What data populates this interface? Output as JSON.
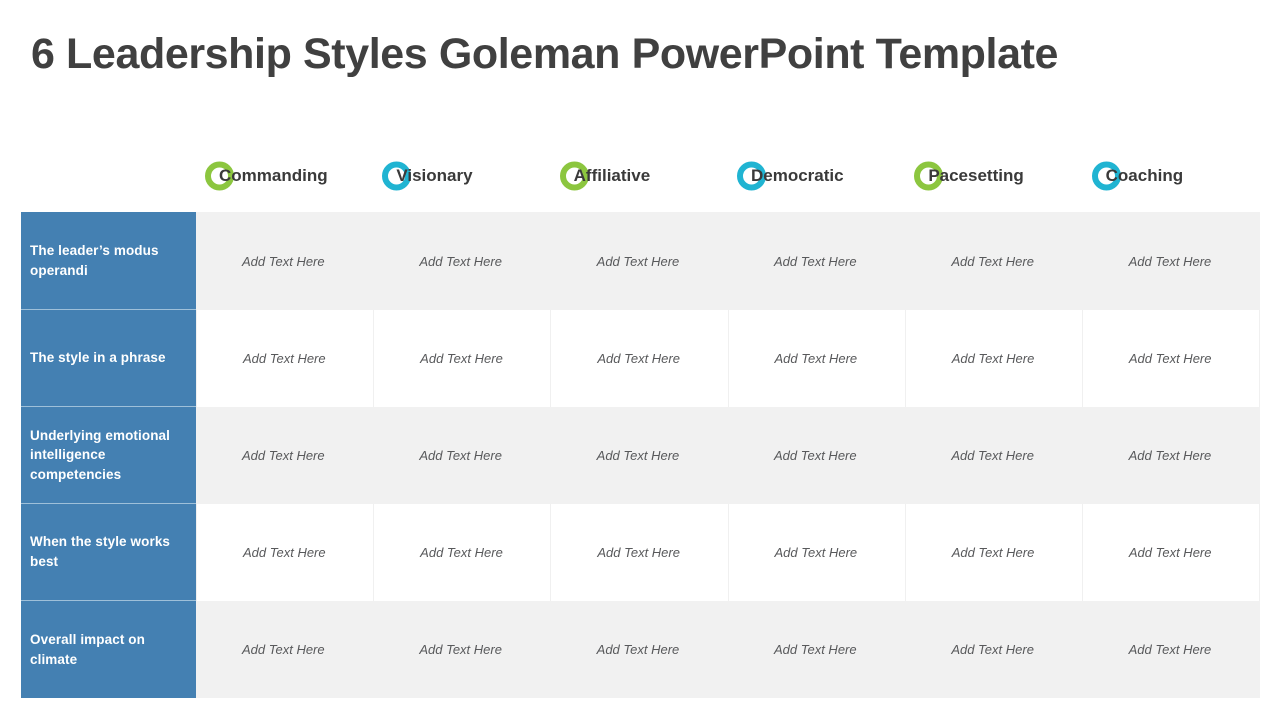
{
  "slide": {
    "title": "6 Leadership Styles Goleman PowerPoint Template",
    "title_color": "#404040",
    "background": "#FFFFFF"
  },
  "theme": {
    "accent_green": "#8CC63F",
    "accent_cyan": "#20B4D2",
    "label_blue": "#4480B2",
    "stripe_gray": "#F1F1F1",
    "cell_text_color": "#58595B",
    "divider_gray": "#F0F0F0"
  },
  "matrix": {
    "corner_label": "",
    "columns": [
      {
        "label": "Commanding",
        "icon": "ring-icon",
        "accent": "green"
      },
      {
        "label": "Visionary",
        "icon": "ring-icon",
        "accent": "cyan"
      },
      {
        "label": "Affiliative",
        "icon": "ring-icon",
        "accent": "green"
      },
      {
        "label": "Democratic",
        "icon": "ring-icon",
        "accent": "cyan"
      },
      {
        "label": "Pacesetting",
        "icon": "ring-icon",
        "accent": "green"
      },
      {
        "label": "Coaching",
        "icon": "ring-icon",
        "accent": "cyan"
      }
    ],
    "rows": [
      {
        "label": "The leader’s modus operandi",
        "stripe": true,
        "cells": [
          "Add Text Here",
          "Add Text Here",
          "Add Text Here",
          "Add Text Here",
          "Add Text Here",
          "Add Text Here"
        ]
      },
      {
        "label": "The style in a phrase",
        "stripe": false,
        "cells": [
          "Add Text Here",
          "Add Text Here",
          "Add Text Here",
          "Add Text Here",
          "Add Text Here",
          "Add Text Here"
        ]
      },
      {
        "label": "Underlying emotional intelligence competencies",
        "stripe": true,
        "cells": [
          "Add Text Here",
          "Add Text Here",
          "Add Text Here",
          "Add Text Here",
          "Add Text Here",
          "Add Text Here"
        ]
      },
      {
        "label": "When the style works best",
        "stripe": false,
        "cells": [
          "Add Text Here",
          "Add Text Here",
          "Add Text Here",
          "Add Text Here",
          "Add Text Here",
          "Add Text Here"
        ]
      },
      {
        "label": "Overall impact on climate",
        "stripe": true,
        "cells": [
          "Add Text Here",
          "Add Text Here",
          "Add Text Here",
          "Add Text Here",
          "Add Text Here",
          "Add Text Here"
        ]
      }
    ]
  }
}
